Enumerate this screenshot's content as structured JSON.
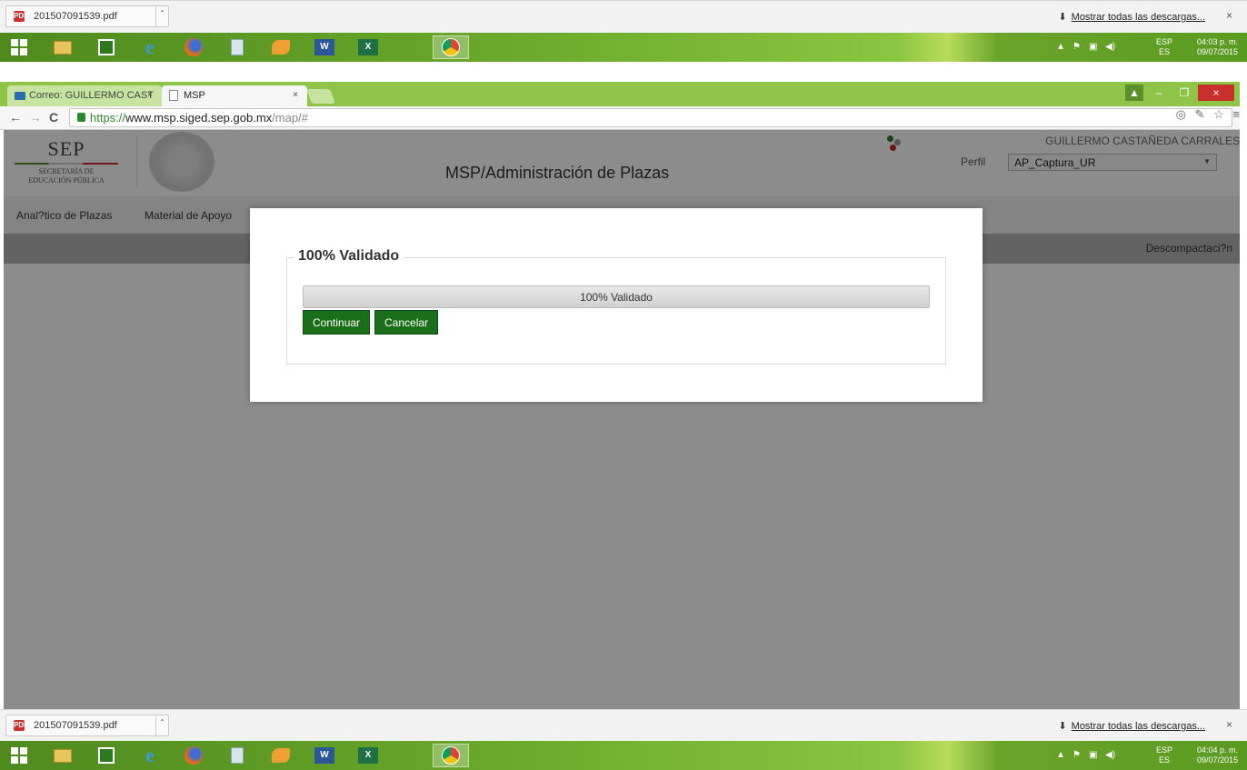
{
  "download_shelf": {
    "file_name": "201507091539.pdf",
    "file_icon_text": "PDF",
    "show_all_label": "Mostrar todas las descargas...",
    "close_glyph": "×"
  },
  "taskbar_top": {
    "lang_line1": "ESP",
    "lang_line2": "ES",
    "time": "04:03 p. m.",
    "date": "09/07/2015"
  },
  "taskbar_bottom": {
    "lang_line1": "ESP",
    "lang_line2": "ES",
    "time": "04:04 p. m.",
    "date": "09/07/2015"
  },
  "taskbar_apps": [
    {
      "name": "start-button",
      "icon": "windows-logo"
    },
    {
      "name": "file-explorer",
      "icon": "folder-icon"
    },
    {
      "name": "store",
      "icon": "store-icon"
    },
    {
      "name": "internet-explorer",
      "icon": "ie-icon"
    },
    {
      "name": "firefox",
      "icon": "firefox-icon"
    },
    {
      "name": "calculator",
      "icon": "calculator-icon"
    },
    {
      "name": "app-fox",
      "icon": "fox-icon"
    },
    {
      "name": "word",
      "icon": "word-icon"
    },
    {
      "name": "excel",
      "icon": "excel-icon"
    },
    {
      "name": "chrome",
      "icon": "chrome-icon"
    }
  ],
  "browser": {
    "tabs": [
      {
        "label": "Correo: GUILLERMO CAST",
        "icon": "mail-icon"
      },
      {
        "label": "MSP",
        "icon": "page-icon"
      }
    ],
    "tab_close_glyph": "×",
    "url_scheme": "https://",
    "url_host": "www.msp.siged.sep.gob.mx",
    "url_path": "/map/#"
  },
  "page": {
    "logo_big": "SEP",
    "logo_line1": "SECRETARÍA DE",
    "logo_line2": "EDUCACIÓN PÚBLICA",
    "app_title": "MSP/Administración de Plazas",
    "user_name": "GUILLERMO CASTAÑEDA CARRALES",
    "perfil_label": "Perfil",
    "perfil_value": "AP_Captura_UR",
    "menu": [
      {
        "label": "Anal?tico de Plazas"
      },
      {
        "label": "Material de Apoyo"
      }
    ],
    "graybar_label": "Descompactaci?n"
  },
  "modal": {
    "legend": "100% Validado",
    "progress_text": "100% Validado",
    "progress_fraction": 1.0,
    "continue_label": "Continuar",
    "cancel_label": "Cancelar"
  },
  "colors": {
    "button_green": "#1b6f1b",
    "taskbar_green": "#6aa82a"
  }
}
